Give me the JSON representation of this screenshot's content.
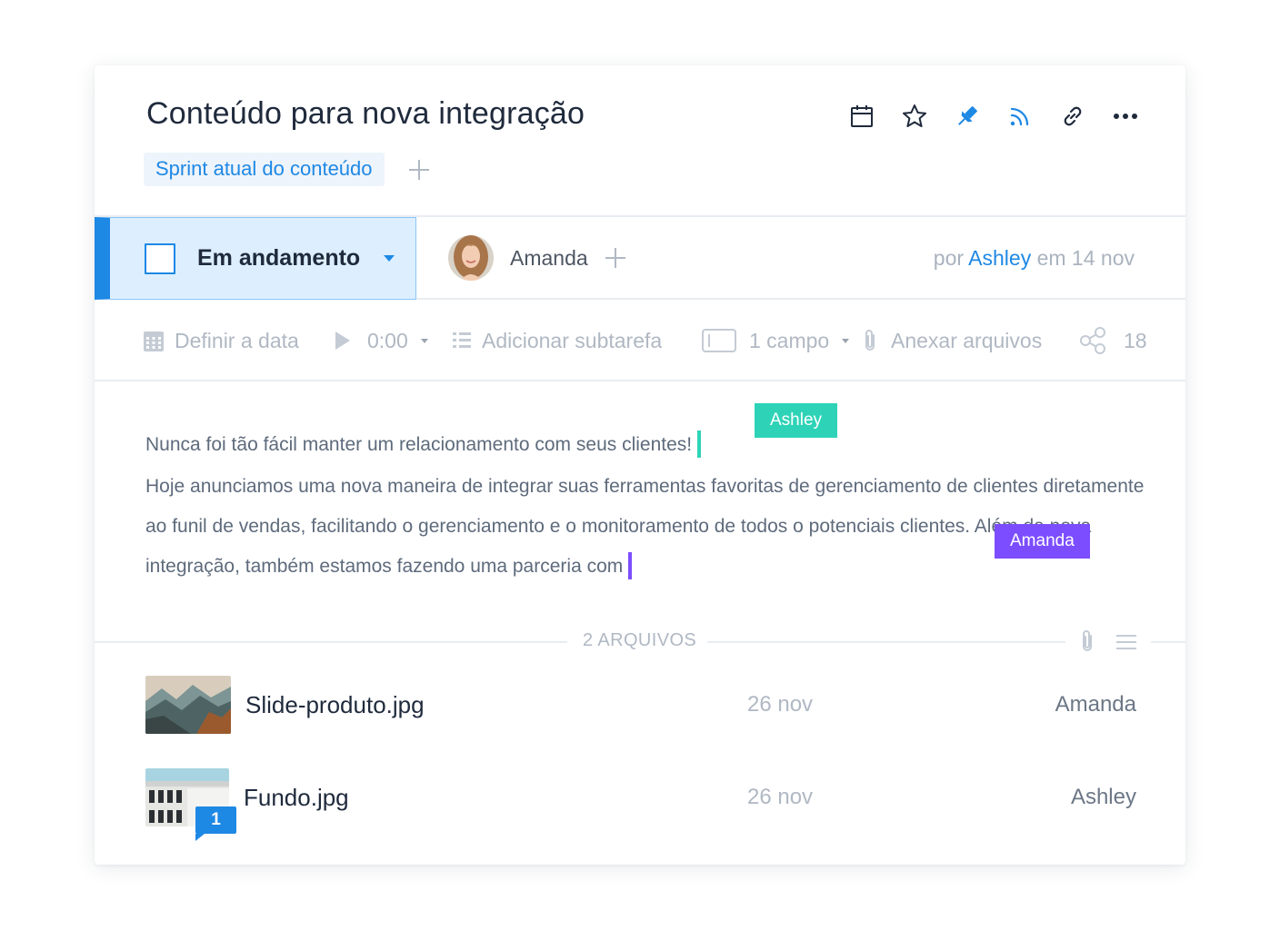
{
  "task": {
    "title": "Conteúdo para nova integração",
    "list_tag": "Sprint atual do conteúdo"
  },
  "toolbar": {
    "icons": [
      "calendar-icon",
      "star-icon",
      "pin-icon",
      "rss-icon",
      "link-icon",
      "more-icon"
    ],
    "pin_active": true
  },
  "status": {
    "label": "Em andamento",
    "assignee": "Amanda",
    "byline_prefix": "por",
    "byline_author": "Ashley",
    "byline_suffix": "em 14 nov"
  },
  "actions": {
    "due_date": "Definir a data",
    "timer": "0:00",
    "subtask": "Adicionar subtarefa",
    "fields": "1 campo",
    "attach": "Anexar arquivos",
    "share_count": "18"
  },
  "content": {
    "line1": "Nunca foi tão fácil manter um relacionamento com seus clientes!",
    "para2_part1": "Hoje anunciamos uma nova maneira de integrar suas ferramentas favoritas de gerenciamento de clientes diretamente ao funil de vendas, facilitando o gerenciamento e o monitoramento de todos o",
    "para2_part2": "potenciais clientes. Além da nova integração, também estamos fazendo uma parceria com",
    "cursors": [
      {
        "name": "Ashley",
        "color": "#2ed3b7"
      },
      {
        "name": "Amanda",
        "color": "#7c4dff"
      }
    ]
  },
  "files": {
    "header": "2 ARQUIVOS",
    "items": [
      {
        "name": "Slide-produto.jpg",
        "date": "26 nov",
        "user": "Amanda",
        "comments": null
      },
      {
        "name": "Fundo.jpg",
        "date": "26 nov",
        "user": "Ashley",
        "comments": "1"
      }
    ]
  },
  "colors": {
    "accent": "#1e88e5",
    "status_bg": "#ddefff",
    "muted_text": "#b0b8c3"
  }
}
